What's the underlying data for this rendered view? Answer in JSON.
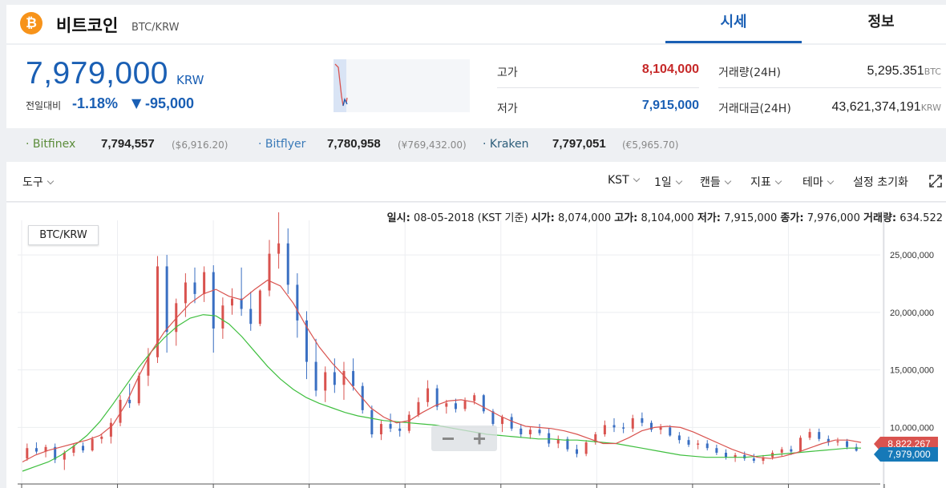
{
  "header": {
    "coin_symbol": "₿",
    "coin_name": "비트코인",
    "pair": "BTC/KRW",
    "tabs": [
      {
        "label": "시세",
        "active": true
      },
      {
        "label": "정보",
        "active": false
      }
    ]
  },
  "price": {
    "current": "7,979,000",
    "unit": "KRW",
    "change_label": "전일대비",
    "change_percent": "-1.18%",
    "change_arrow": "▼",
    "change_amount": "-95,000"
  },
  "stats": {
    "high_label": "고가",
    "high_value": "8,104,000",
    "low_label": "저가",
    "low_value": "7,915,000",
    "volume_label": "거래량(24H)",
    "volume_value": "5,295.351",
    "volume_unit": "BTC",
    "amount_label": "거래대금(24H)",
    "amount_value": "43,621,374,191",
    "amount_unit": "KRW"
  },
  "exchanges": [
    {
      "name": "Bitfinex",
      "price": "7,794,557",
      "sub": "($6,916.20)",
      "color": "#5b8c3a"
    },
    {
      "name": "Bitflyer",
      "price": "7,780,958",
      "sub": "(¥769,432.00)",
      "color": "#3a7ab8"
    },
    {
      "name": "Kraken",
      "price": "7,797,051",
      "sub": "(€5,965.70)",
      "color": "#2c5d7a"
    }
  ],
  "toolbar": {
    "tools_label": "도구",
    "timezone": "KST",
    "interval": "1일",
    "chart_type": "캔들",
    "indicators": "지표",
    "theme": "테마",
    "reset": "설정 초기화"
  },
  "ohlc": {
    "date_label": "일시:",
    "date": "08-05-2018 (KST 기준)",
    "open_label": "시가:",
    "open": "8,074,000",
    "high_label": "고가:",
    "high": "8,104,000",
    "low_label": "저가:",
    "low": "7,915,000",
    "close_label": "종가:",
    "close": "7,976,000",
    "volume_label": "거래량:",
    "volume": "634.522"
  },
  "chart": {
    "pair_label": "BTC/KRW",
    "ma_tag": "8,822,267",
    "current_tag": "7,979,000",
    "colors": {
      "up": "#d9534f",
      "down": "#3a6fc2",
      "ma_short": "#d9534f",
      "ma_long": "#3fbf3f"
    }
  },
  "chart_data": {
    "type": "line",
    "ylim": [
      5500000,
      28000000
    ],
    "y_ticks": [
      "10,000,000",
      "15,000,000",
      "20,000,000",
      "25,000,000"
    ],
    "y_tick_values": [
      10000000,
      15000000,
      20000000,
      25000000
    ],
    "candles": [
      [
        7.3,
        8.6,
        7.1,
        8.2
      ],
      [
        8.2,
        8.7,
        7.7,
        7.9
      ],
      [
        7.9,
        8.5,
        7.4,
        8.3
      ],
      [
        8.3,
        8.6,
        6.9,
        7.2
      ],
      [
        7.2,
        8.0,
        6.3,
        7.8
      ],
      [
        7.8,
        8.6,
        7.5,
        8.4
      ],
      [
        8.4,
        8.7,
        7.8,
        8.0
      ],
      [
        8.0,
        9.2,
        7.9,
        9.0
      ],
      [
        9.0,
        9.4,
        8.6,
        9.2
      ],
      [
        9.2,
        10.8,
        8.6,
        10.4
      ],
      [
        10.4,
        12.8,
        10.1,
        12.4
      ],
      [
        12.4,
        13.8,
        11.7,
        12.1
      ],
      [
        12.1,
        14.8,
        11.9,
        14.5
      ],
      [
        14.5,
        16.9,
        13.6,
        16.1
      ],
      [
        16.1,
        24.9,
        15.6,
        24.0
      ],
      [
        24.0,
        25.0,
        16.5,
        18.3
      ],
      [
        18.3,
        21.2,
        17.1,
        20.8
      ],
      [
        20.8,
        23.4,
        19.6,
        22.6
      ],
      [
        22.6,
        23.9,
        20.8,
        21.6
      ],
      [
        21.6,
        24.0,
        20.9,
        23.5
      ],
      [
        23.5,
        24.1,
        16.5,
        18.6
      ],
      [
        18.6,
        21.3,
        17.7,
        20.6
      ],
      [
        20.6,
        22.1,
        19.8,
        21.2
      ],
      [
        21.2,
        23.9,
        19.7,
        20.3
      ],
      [
        20.3,
        21.8,
        18.4,
        19.0
      ],
      [
        19.0,
        22.0,
        18.8,
        21.9
      ],
      [
        21.9,
        26.3,
        21.4,
        25.1
      ],
      [
        25.1,
        28.7,
        23.8,
        26.0
      ],
      [
        26.0,
        27.3,
        21.6,
        22.4
      ],
      [
        22.4,
        23.4,
        17.8,
        19.3
      ],
      [
        19.3,
        20.1,
        14.2,
        15.7
      ],
      [
        15.7,
        17.7,
        12.7,
        13.2
      ],
      [
        13.2,
        15.3,
        12.2,
        14.8
      ],
      [
        14.8,
        16.0,
        13.0,
        13.7
      ],
      [
        13.7,
        15.7,
        12.4,
        14.9
      ],
      [
        14.9,
        16.0,
        13.2,
        13.6
      ],
      [
        13.6,
        13.9,
        11.2,
        11.5
      ],
      [
        11.5,
        11.9,
        9.1,
        9.4
      ],
      [
        9.4,
        10.6,
        8.9,
        10.3
      ],
      [
        10.3,
        11.2,
        9.6,
        9.9
      ],
      [
        9.9,
        10.5,
        9.2,
        9.7
      ],
      [
        9.7,
        11.4,
        9.5,
        11.1
      ],
      [
        11.1,
        12.6,
        10.9,
        12.2
      ],
      [
        12.2,
        14.1,
        11.8,
        13.4
      ],
      [
        13.4,
        13.7,
        11.5,
        11.8
      ],
      [
        11.8,
        12.4,
        11.2,
        12.1
      ],
      [
        12.1,
        12.5,
        11.3,
        11.6
      ],
      [
        11.6,
        12.6,
        11.4,
        12.3
      ],
      [
        12.3,
        13.0,
        12.0,
        12.8
      ],
      [
        12.8,
        12.9,
        11.2,
        11.4
      ],
      [
        11.4,
        11.6,
        10.1,
        10.3
      ],
      [
        10.3,
        11.1,
        9.6,
        10.9
      ],
      [
        10.9,
        11.2,
        9.7,
        9.9
      ],
      [
        9.9,
        10.3,
        9.1,
        9.4
      ],
      [
        9.4,
        10.1,
        9.0,
        9.8
      ],
      [
        9.8,
        10.3,
        9.3,
        9.5
      ],
      [
        9.5,
        9.9,
        8.3,
        8.6
      ],
      [
        8.6,
        9.3,
        8.2,
        9.0
      ],
      [
        9.0,
        9.2,
        7.9,
        8.1
      ],
      [
        8.1,
        8.5,
        7.4,
        7.7
      ],
      [
        7.7,
        8.9,
        7.5,
        8.7
      ],
      [
        8.7,
        9.6,
        8.5,
        9.4
      ],
      [
        9.4,
        10.6,
        9.2,
        10.2
      ],
      [
        10.2,
        10.8,
        9.6,
        10.0
      ],
      [
        10.0,
        10.4,
        9.5,
        9.9
      ],
      [
        9.9,
        11.1,
        9.6,
        10.8
      ],
      [
        10.8,
        11.3,
        10.1,
        10.4
      ],
      [
        10.4,
        10.6,
        9.6,
        9.8
      ],
      [
        9.8,
        10.3,
        9.4,
        10.0
      ],
      [
        10.0,
        10.2,
        9.2,
        9.3
      ],
      [
        9.3,
        9.6,
        8.6,
        8.9
      ],
      [
        8.9,
        9.2,
        8.3,
        8.5
      ],
      [
        8.5,
        8.9,
        8.1,
        8.6
      ],
      [
        8.6,
        8.9,
        8.0,
        8.2
      ],
      [
        8.2,
        8.5,
        7.6,
        7.8
      ],
      [
        7.8,
        8.1,
        7.2,
        7.4
      ],
      [
        7.4,
        7.8,
        7.0,
        7.6
      ],
      [
        7.6,
        7.9,
        7.1,
        7.3
      ],
      [
        7.3,
        7.7,
        6.9,
        7.1
      ],
      [
        7.1,
        7.6,
        6.8,
        7.4
      ],
      [
        7.4,
        8.0,
        7.2,
        7.8
      ],
      [
        7.8,
        8.3,
        7.5,
        8.1
      ],
      [
        8.1,
        8.4,
        7.6,
        7.9
      ],
      [
        7.9,
        9.3,
        7.8,
        9.1
      ],
      [
        9.1,
        9.9,
        8.9,
        9.6
      ],
      [
        9.6,
        9.9,
        8.8,
        9.0
      ],
      [
        9.0,
        9.3,
        8.4,
        8.7
      ],
      [
        8.7,
        9.1,
        8.4,
        8.8
      ],
      [
        8.8,
        9.0,
        8.1,
        8.3
      ],
      [
        8.3,
        8.6,
        7.9,
        7.979
      ]
    ],
    "ma_short": [
      7.0,
      7.6,
      8.0,
      8.3,
      8.6,
      8.9,
      9.3,
      10.2,
      12.0,
      14.4,
      16.6,
      18.3,
      19.6,
      20.8,
      21.6,
      22.0,
      21.4,
      21.1,
      22.0,
      22.8,
      22.3,
      20.8,
      18.8,
      17.0,
      15.6,
      14.4,
      13.0,
      11.7,
      10.9,
      10.4,
      10.6,
      11.3,
      11.9,
      12.3,
      12.4,
      12.2,
      11.6,
      11.0,
      10.5,
      10.1,
      10.0,
      9.9,
      9.7,
      9.4,
      9.0,
      8.6,
      8.6,
      9.1,
      9.7,
      10.0,
      10.1,
      10.0,
      9.6,
      9.1,
      8.6,
      8.1,
      7.7,
      7.4,
      7.3,
      7.5,
      7.8,
      8.2,
      8.6,
      8.9,
      8.9,
      8.7
    ],
    "ma_long": [
      6.2,
      6.6,
      7.0,
      7.6,
      8.4,
      9.3,
      10.5,
      12.0,
      13.6,
      15.2,
      16.6,
      17.8,
      18.8,
      19.5,
      19.8,
      19.7,
      19.0,
      17.9,
      16.6,
      15.3,
      14.2,
      13.3,
      12.6,
      12.1,
      11.7,
      11.3,
      11.0,
      10.8,
      10.6,
      10.5,
      10.4,
      10.3,
      10.2,
      10.0,
      9.8,
      9.6,
      9.4,
      9.3,
      9.2,
      9.1,
      9.0,
      9.0,
      8.9,
      8.9,
      8.8,
      8.7,
      8.6,
      8.4,
      8.2,
      8.0,
      7.8,
      7.6,
      7.5,
      7.4,
      7.4,
      7.4,
      7.4,
      7.5,
      7.6,
      7.7,
      7.8,
      7.9,
      8.0,
      8.1,
      8.2,
      8.2
    ]
  }
}
